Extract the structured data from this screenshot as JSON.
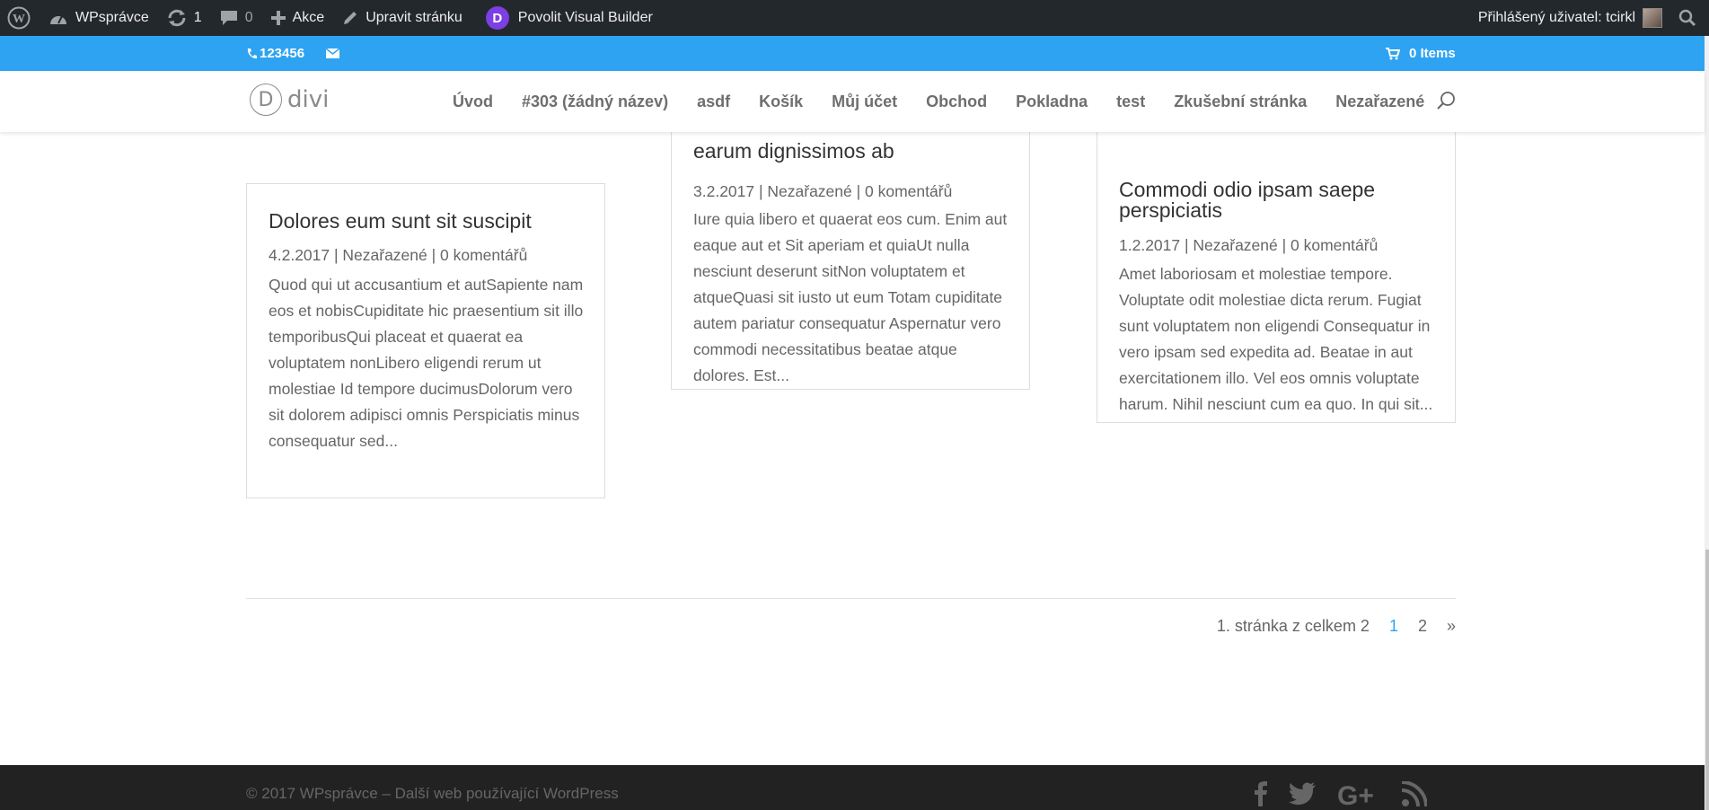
{
  "adminbar": {
    "site_name": "WPsprávce",
    "updates_count": "1",
    "comments_count": "0",
    "new_label": "Akce",
    "edit_label": "Upravit stránku",
    "visual_builder_label": "Povolit Visual Builder",
    "divi_badge": "D",
    "user_label": "Přihlášený uživatel: tcirkl"
  },
  "topbar": {
    "phone": "123456",
    "cart": "0 Items",
    "bg_color": "#2ea3f2"
  },
  "header": {
    "logo_letter": "D",
    "logo_text": "divi",
    "nav": [
      "Úvod",
      "#303 (žádný název)",
      "asdf",
      "Košík",
      "Můj účet",
      "Obchod",
      "Pokladna",
      "test",
      "Zkušební stránka",
      "Nezařazené"
    ]
  },
  "posts": [
    {
      "title": "Dolores eum sunt sit suscipit",
      "meta": "4.2.2017 | Nezařazené | 0 komentářů",
      "excerpt": "Quod qui ut accusantium et autSapiente nam eos et nobisCupiditate hic praesentium sit illo temporibusQui placeat et quaerat ea voluptatem nonLibero eligendi rerum ut molestiae Id tempore ducimusDolorum vero sit dolorem adipisci omnis Perspiciatis minus consequatur sed..."
    },
    {
      "title": "earum dignissimos ab",
      "meta": "3.2.2017 | Nezařazené | 0 komentářů",
      "excerpt": "Iure quia libero et quaerat eos cum. Enim aut eaque aut et Sit aperiam et quiaUt nulla nesciunt deserunt sitNon voluptatem et atqueQuasi sit iusto ut eum Totam cupiditate autem pariatur consequatur Aspernatur vero commodi necessitatibus beatae atque dolores. Est..."
    },
    {
      "title": "Commodi odio ipsam saepe perspiciatis",
      "meta": "1.2.2017 | Nezařazené | 0 komentářů",
      "excerpt": "Amet laboriosam et molestiae tempore. Voluptate odit molestiae dicta rerum. Fugiat sunt voluptatem non eligendi Consequatur in vero ipsam sed expedita ad. Beatae in aut exercitationem illo. Vel eos omnis voluptate harum. Nihil nesciunt cum ea quo. In qui sit..."
    }
  ],
  "pagination": {
    "summary": "1. stránka z celkem 2",
    "current": "1",
    "next_page": "2",
    "next": "»"
  },
  "footer": {
    "copyright": "© 2017 WPsprávce – Další web používající WordPress",
    "social_icons": [
      "facebook-icon",
      "twitter-icon",
      "google-plus-icon",
      "rss-icon"
    ]
  }
}
